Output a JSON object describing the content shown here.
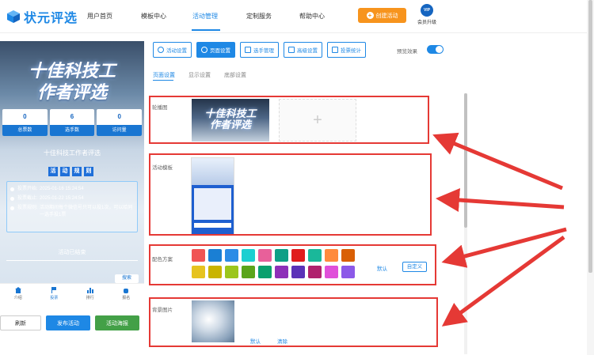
{
  "brand": {
    "name": "状元评选"
  },
  "nav": {
    "items": [
      {
        "label": "用户首页"
      },
      {
        "label": "模板中心"
      },
      {
        "label": "活动管理"
      },
      {
        "label": "定制服务"
      },
      {
        "label": "帮助中心"
      }
    ],
    "create_label": "创建活动",
    "vip_badge": "VIP",
    "vip_label": "会员升级"
  },
  "preview": {
    "title_line1": "十佳科技工",
    "title_line2": "作者评选",
    "stats": [
      {
        "value": "0",
        "label": "总票数"
      },
      {
        "value": "6",
        "label": "选手数"
      },
      {
        "value": "0",
        "label": "访问量"
      }
    ],
    "activity_name": "十佳科技工作者评选",
    "rules_chars": [
      "活",
      "动",
      "规",
      "则"
    ],
    "info": [
      {
        "key": "投票开始:",
        "value": "2025-01-16 15:24:54"
      },
      {
        "key": "投票截止:",
        "value": "2025-01-22 15:24:54"
      },
      {
        "key": "投票规则:",
        "value": "活动期间每个微信号只可以投1次，可以给同一选手投1票"
      }
    ],
    "ended_text": "活动已结束",
    "search_label": "搜索",
    "tabs": [
      {
        "label": "介绍"
      },
      {
        "label": "投票"
      },
      {
        "label": "排行"
      },
      {
        "label": "报名"
      }
    ]
  },
  "actions": {
    "refresh": "刷新",
    "publish": "发布活动",
    "poster": "活动海报"
  },
  "toolbar": {
    "buttons": [
      {
        "label": "活动设置"
      },
      {
        "label": "页面设置"
      },
      {
        "label": "选手管理"
      },
      {
        "label": "高级设置"
      },
      {
        "label": "投票统计"
      }
    ],
    "preview_toggle_label": "预览效果"
  },
  "subtabs": [
    {
      "label": "页面设置"
    },
    {
      "label": "显示设置"
    },
    {
      "label": "底部设置"
    }
  ],
  "sections": {
    "carousel_label": "轮播图",
    "carousel_banner_line1": "十佳科技工",
    "carousel_banner_line2": "作者评选",
    "add_symbol": "+",
    "template_label": "活动模板",
    "color_label": "配色方案",
    "color_default": "默认",
    "color_custom": "自定义",
    "bg_label": "背景图片",
    "bg_default": "默认",
    "bg_clear": "清除"
  },
  "palette": [
    "#f05454",
    "#1a7fd4",
    "#2b8ce6",
    "#1ccfd1",
    "#e8609a",
    "#0e9f86",
    "#e01c1c",
    "#1ab89a",
    "#ff8a3d",
    "#d95f05",
    "#e6c31f",
    "#c9b400",
    "#9bc61d",
    "#5aa51b",
    "#0aa06e",
    "#8e2fb8",
    "#5b32b8",
    "#b0226e",
    "#e04fd9",
    "#8c59e8"
  ]
}
